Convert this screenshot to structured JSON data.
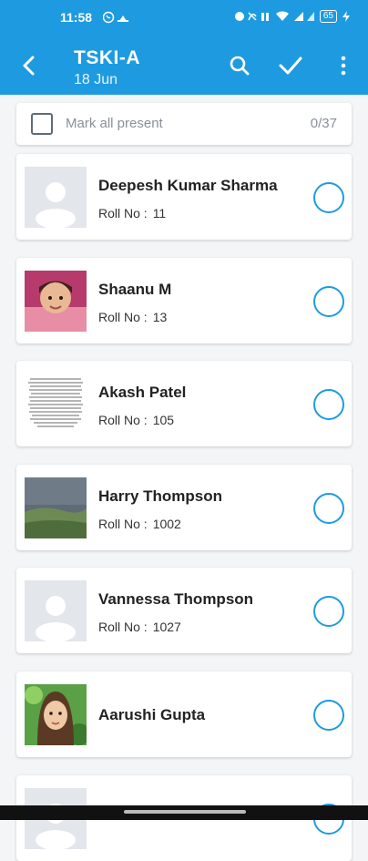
{
  "status_bar": {
    "time": "11:58",
    "battery": "65"
  },
  "appbar": {
    "title": "TSKI-A",
    "subtitle": "18 Jun"
  },
  "mark_all": {
    "label": "Mark all present",
    "count": "0/37"
  },
  "roll_label": "Roll No :",
  "students": [
    {
      "name": "Deepesh Kumar Sharma",
      "roll": "11",
      "photo": "placeholder"
    },
    {
      "name": "Shaanu M",
      "roll": "13",
      "photo": "child-girl"
    },
    {
      "name": "Akash Patel",
      "roll": "105",
      "photo": "document"
    },
    {
      "name": "Harry Thompson",
      "roll": "1002",
      "photo": "landscape"
    },
    {
      "name": "Vannessa Thompson",
      "roll": "1027",
      "photo": "placeholder"
    },
    {
      "name": "Aarushi Gupta",
      "roll": "",
      "photo": "child-girl"
    }
  ],
  "colors": {
    "primary": "#1e9be0",
    "background": "#f4f5f7"
  }
}
